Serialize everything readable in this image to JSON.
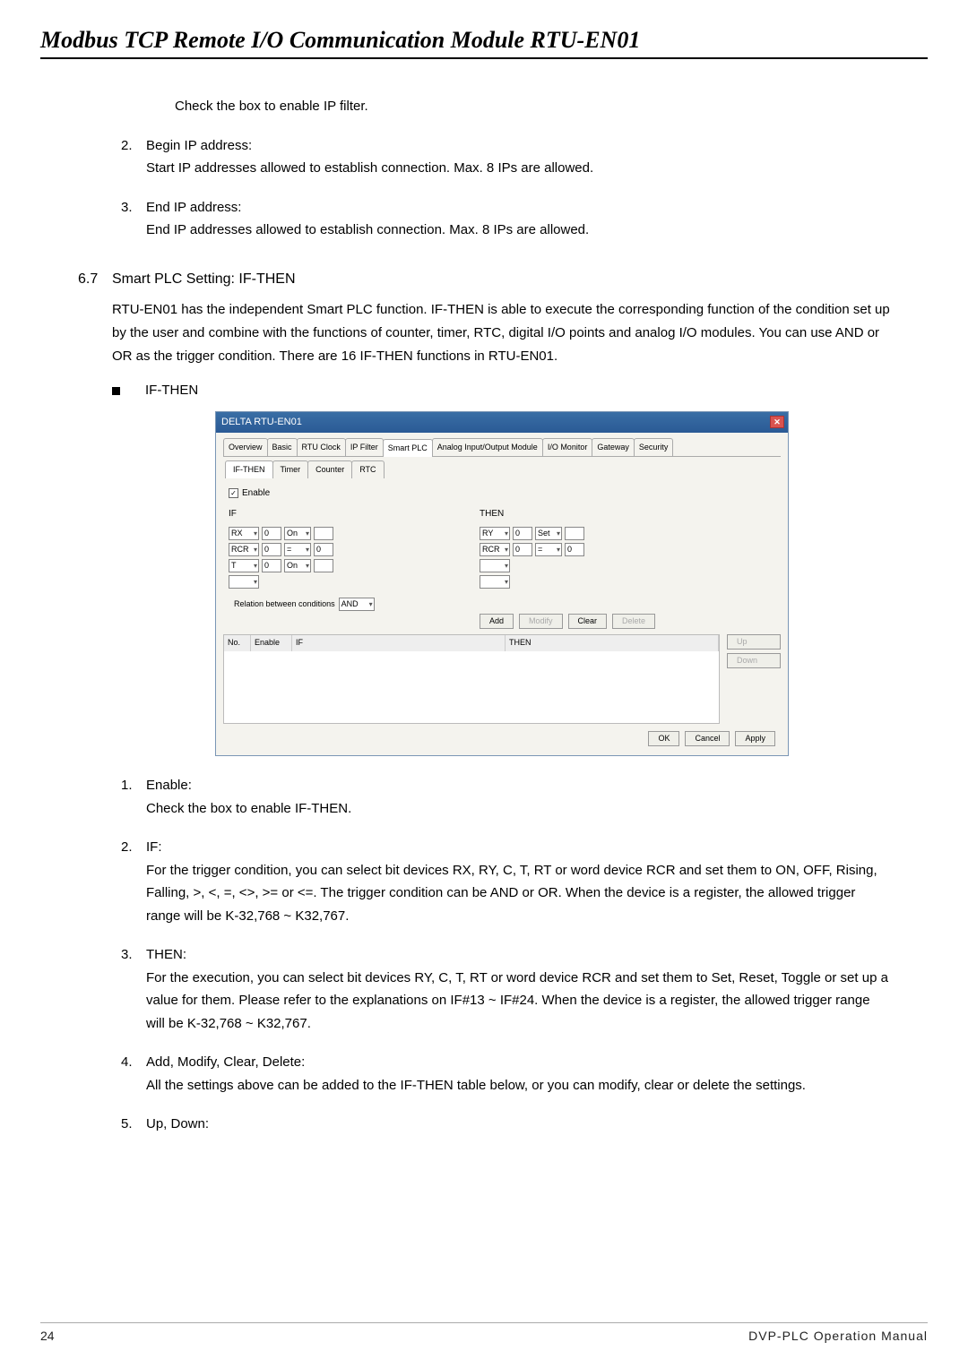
{
  "doc_title": "Modbus TCP Remote I/O Communication Module RTU-EN01",
  "intro_line": "Check the box to enable IP filter.",
  "pre_items": [
    {
      "num": "2.",
      "title": "Begin IP address:",
      "body": "Start IP addresses allowed to establish connection. Max. 8 IPs are allowed."
    },
    {
      "num": "3.",
      "title": "End IP address:",
      "body": "End IP addresses allowed to establish connection. Max. 8 IPs are allowed."
    }
  ],
  "section": {
    "num": "6.7",
    "title": "Smart PLC Setting: IF-THEN",
    "body": "RTU-EN01 has the independent Smart PLC function. IF-THEN is able to execute the corresponding function of the condition set up by the user and combine with the functions of counter, timer, RTC, digital I/O points and analog I/O modules. You can use AND or OR as the trigger condition. There are 16 IF-THEN functions in RTU-EN01.",
    "bullet": "IF-THEN"
  },
  "dialog": {
    "title": "DELTA RTU-EN01",
    "tabs": [
      "Overview",
      "Basic",
      "RTU Clock",
      "IP Filter",
      "Smart PLC",
      "Analog Input/Output Module",
      "I/O Monitor",
      "Gateway",
      "Security"
    ],
    "active_tab": "Smart PLC",
    "subtabs": [
      "IF-THEN",
      "Timer",
      "Counter",
      "RTC"
    ],
    "active_subtab": "IF-THEN",
    "enable_label": "Enable",
    "if_label": "IF",
    "then_label": "THEN",
    "if_rows": [
      {
        "a": "RX",
        "b": "0",
        "c": "On",
        "d": ""
      },
      {
        "a": "RCR",
        "b": "0",
        "c": "=",
        "d": "0"
      },
      {
        "a": "T",
        "b": "0",
        "c": "On",
        "d": ""
      },
      {
        "a": "",
        "b": "",
        "c": "",
        "d": ""
      }
    ],
    "then_rows": [
      {
        "a": "RY",
        "b": "0",
        "c": "Set",
        "d": ""
      },
      {
        "a": "RCR",
        "b": "0",
        "c": "=",
        "d": "0"
      },
      {
        "a": "",
        "b": "",
        "c": "",
        "d": ""
      },
      {
        "a": "",
        "b": "",
        "c": "",
        "d": ""
      }
    ],
    "relation_label": "Relation between conditions",
    "relation_val": "AND",
    "buttons": {
      "add": "Add",
      "modify": "Modify",
      "clear": "Clear",
      "delete": "Delete",
      "up": "Up",
      "down": "Down",
      "ok": "OK",
      "cancel": "Cancel",
      "apply": "Apply"
    },
    "grid_headers": [
      "No.",
      "Enable",
      "IF",
      "THEN"
    ]
  },
  "post_items": [
    {
      "num": "1.",
      "title": "Enable:",
      "body": "Check the box to enable IF-THEN."
    },
    {
      "num": "2.",
      "title": "IF:",
      "body": "For the trigger condition, you can select bit devices RX, RY, C, T, RT or word device RCR and set them to ON, OFF, Rising, Falling, >, <, =, <>, >= or <=. The trigger condition can be AND or OR. When the device is a register, the allowed trigger range will be K-32,768 ~ K32,767."
    },
    {
      "num": "3.",
      "title": "THEN:",
      "body": "For the execution, you can select bit devices RY, C, T, RT or word device RCR and set them to Set, Reset, Toggle or set up a value for them. Please refer to the explanations on IF#13 ~ IF#24. When the device is a register, the allowed trigger range will be K-32,768 ~ K32,767."
    },
    {
      "num": "4.",
      "title": "Add, Modify, Clear, Delete:",
      "body": "All the settings above can be added to the IF-THEN table below, or you can modify, clear or delete the settings."
    },
    {
      "num": "5.",
      "title": "Up, Down:",
      "body": ""
    }
  ],
  "footer": {
    "page": "24",
    "manual": "DVP-PLC Operation Manual"
  }
}
